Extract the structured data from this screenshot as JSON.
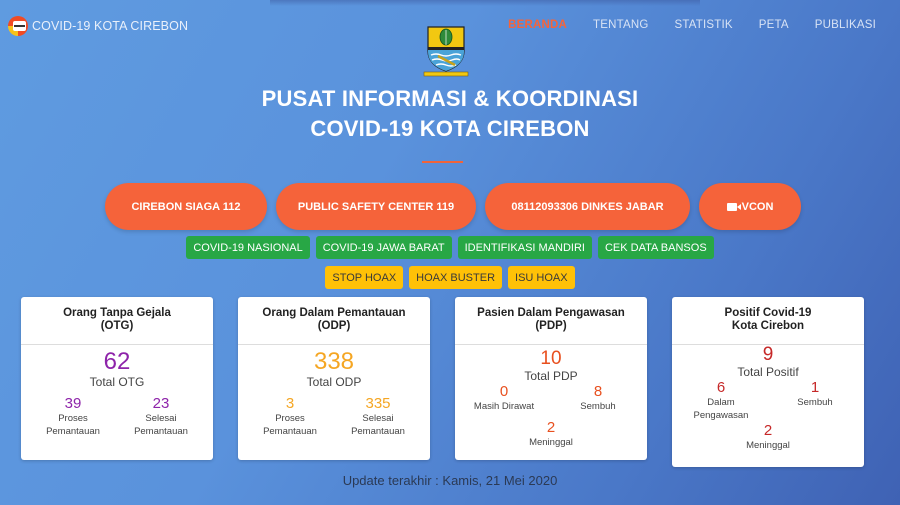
{
  "header": {
    "brand_text": "COVID-19 KOTA CIREBON",
    "nav": [
      {
        "label": "BERANDA",
        "active": true
      },
      {
        "label": "TENTANG",
        "active": false
      },
      {
        "label": "STATISTIK",
        "active": false
      },
      {
        "label": "PETA",
        "active": false
      },
      {
        "label": "PUBLIKASI",
        "active": false
      }
    ]
  },
  "hero": {
    "title_line1": "PUSAT INFORMASI & KOORDINASI",
    "title_line2": "COVID-19 KOTA CIREBON"
  },
  "hotlines": [
    {
      "label": "CIREBON SIAGA 112"
    },
    {
      "label": "PUBLIC SAFETY CENTER 119"
    },
    {
      "label": "08112093306 DINKES JABAR"
    },
    {
      "label": "VCON",
      "icon": "video-camera-icon"
    }
  ],
  "links_green": [
    {
      "label": "COVID-19 NASIONAL"
    },
    {
      "label": "COVID-19 JAWA BARAT"
    },
    {
      "label": "IDENTIFIKASI MANDIRI"
    },
    {
      "label": "CEK DATA BANSOS"
    }
  ],
  "links_yellow": [
    {
      "label": "STOP HOAX"
    },
    {
      "label": "HOAX BUSTER"
    },
    {
      "label": "ISU HOAX"
    }
  ],
  "colors": {
    "accent": "#f5633a",
    "green": "#28a745",
    "yellow": "#ffc107",
    "otg": "#8e24aa",
    "odp": "#f5a623",
    "pdp": "#e8501f",
    "positif": "#c62828"
  },
  "cards": {
    "otg": {
      "title_line1": "Orang Tanpa Gejala",
      "title_line2": "(OTG)",
      "total": "62",
      "total_label": "Total OTG",
      "sub": [
        {
          "value": "39",
          "label_line1": "Proses",
          "label_line2": "Pemantauan"
        },
        {
          "value": "23",
          "label_line1": "Selesai",
          "label_line2": "Pemantauan"
        }
      ]
    },
    "odp": {
      "title_line1": "Orang Dalam Pemantauan",
      "title_line2": "(ODP)",
      "total": "338",
      "total_label": "Total ODP",
      "sub": [
        {
          "value": "3",
          "label_line1": "Proses",
          "label_line2": "Pemantauan"
        },
        {
          "value": "335",
          "label_line1": "Selesai",
          "label_line2": "Pemantauan"
        }
      ]
    },
    "pdp": {
      "title_line1": "Pasien Dalam Pengawasan",
      "title_line2": "(PDP)",
      "total": "10",
      "total_label": "Total PDP",
      "sub": [
        {
          "value": "0",
          "label_line1": "Masih Dirawat"
        },
        {
          "value": "8",
          "label_line1": "Sembuh"
        }
      ],
      "bottom": {
        "value": "2",
        "label": "Meninggal"
      }
    },
    "positif": {
      "title_line1": "Positif Covid-19",
      "title_line2": "Kota Cirebon",
      "total": "9",
      "total_label": "Total Positif",
      "sub": [
        {
          "value": "6",
          "label_line1": "Dalam",
          "label_line2": "Pengawasan"
        },
        {
          "value": "1",
          "label_line1": "Sembuh"
        }
      ],
      "bottom": {
        "value": "2",
        "label": "Meninggal"
      }
    }
  },
  "update_text": "Update terakhir : Kamis, 21 Mei 2020"
}
